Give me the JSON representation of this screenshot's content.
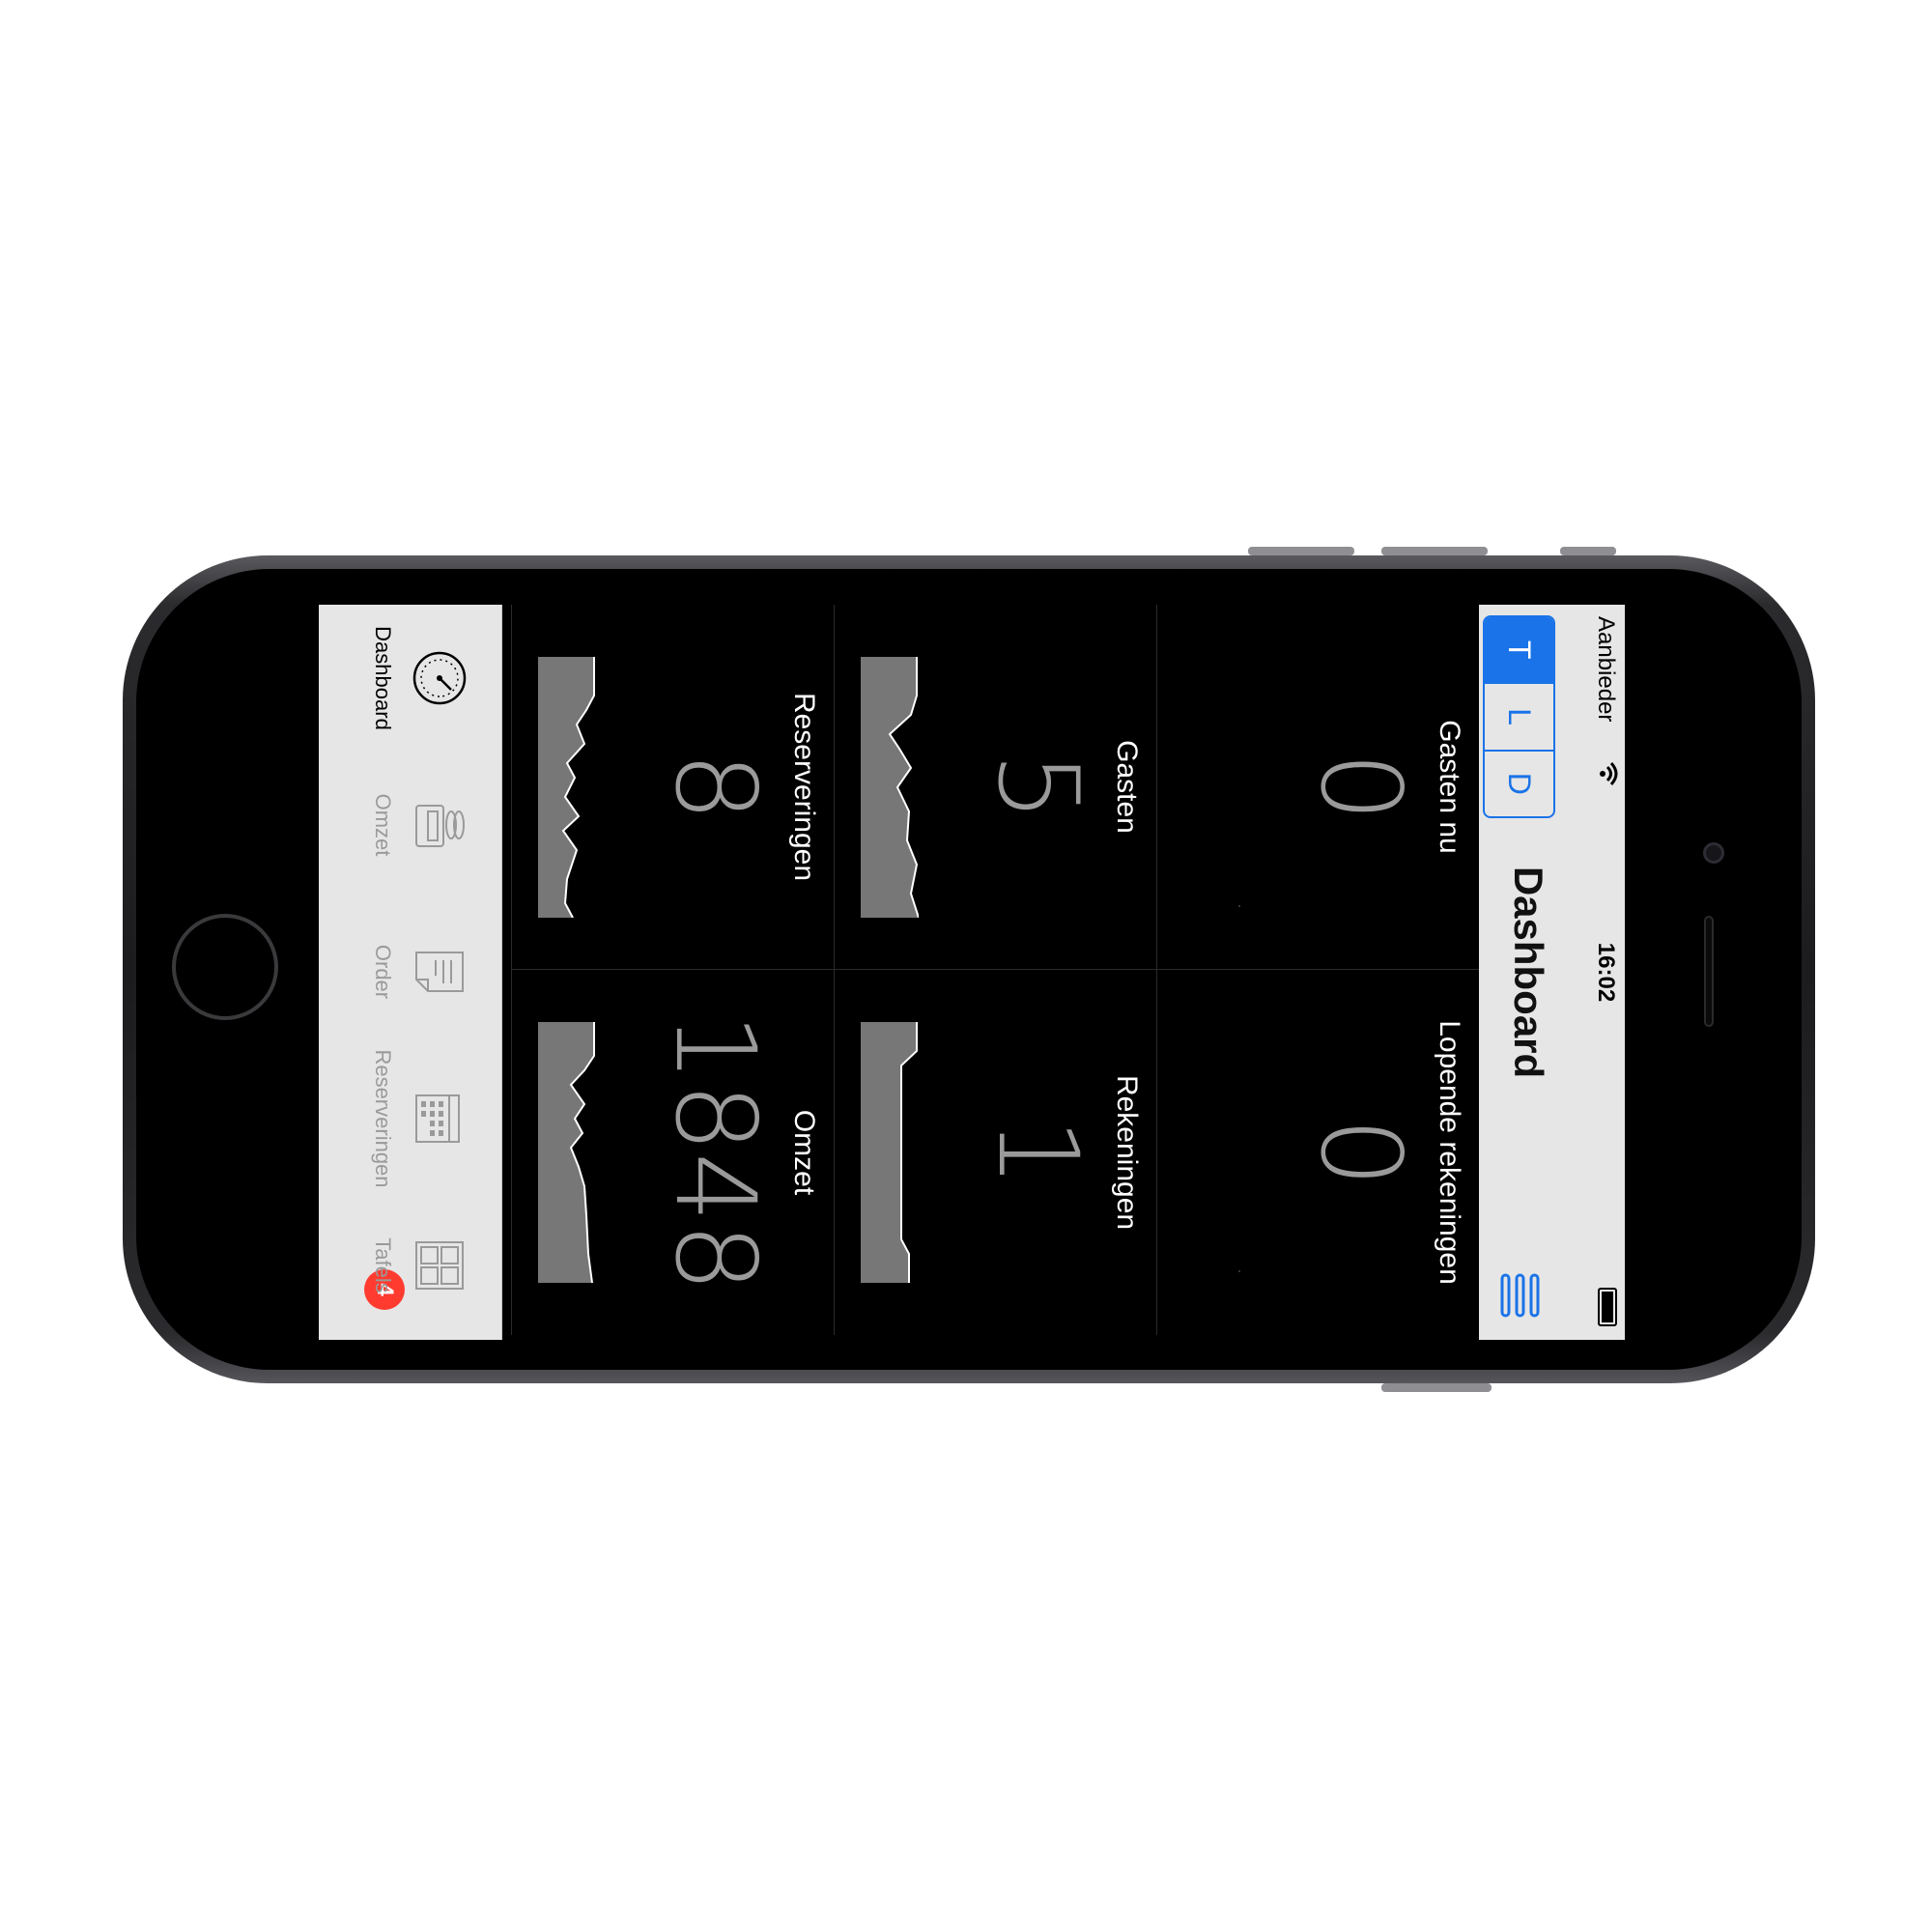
{
  "status_bar": {
    "carrier": "Aanbieder",
    "time": "16:02"
  },
  "nav": {
    "title": "Dashboard",
    "segments": [
      "T",
      "L",
      "D"
    ],
    "active_segment": "T"
  },
  "tiles": [
    {
      "label": "Gasten nu",
      "value": "0"
    },
    {
      "label": "Lopende rekeningen",
      "value": "0"
    },
    {
      "label": "Gasten",
      "value": "5"
    },
    {
      "label": "Rekeningen",
      "value": "1"
    },
    {
      "label": "Reserveringen",
      "value": "8"
    },
    {
      "label": "Omzet",
      "value": "1848"
    }
  ],
  "tabs": [
    {
      "label": "Dashboard",
      "icon": "gauge-icon",
      "active": true
    },
    {
      "label": "Omzet",
      "icon": "register-icon",
      "active": false
    },
    {
      "label": "Order",
      "icon": "receipt-icon",
      "active": false
    },
    {
      "label": "Reserveringen",
      "icon": "calendar-icon",
      "active": false
    },
    {
      "label": "Tafels",
      "icon": "tables-icon",
      "active": false,
      "badge": "4"
    }
  ],
  "colors": {
    "accent": "#1a73e8",
    "badge": "#ff3b30",
    "tile_bg": "#000000",
    "bar_bg": "#e6e6e6"
  }
}
